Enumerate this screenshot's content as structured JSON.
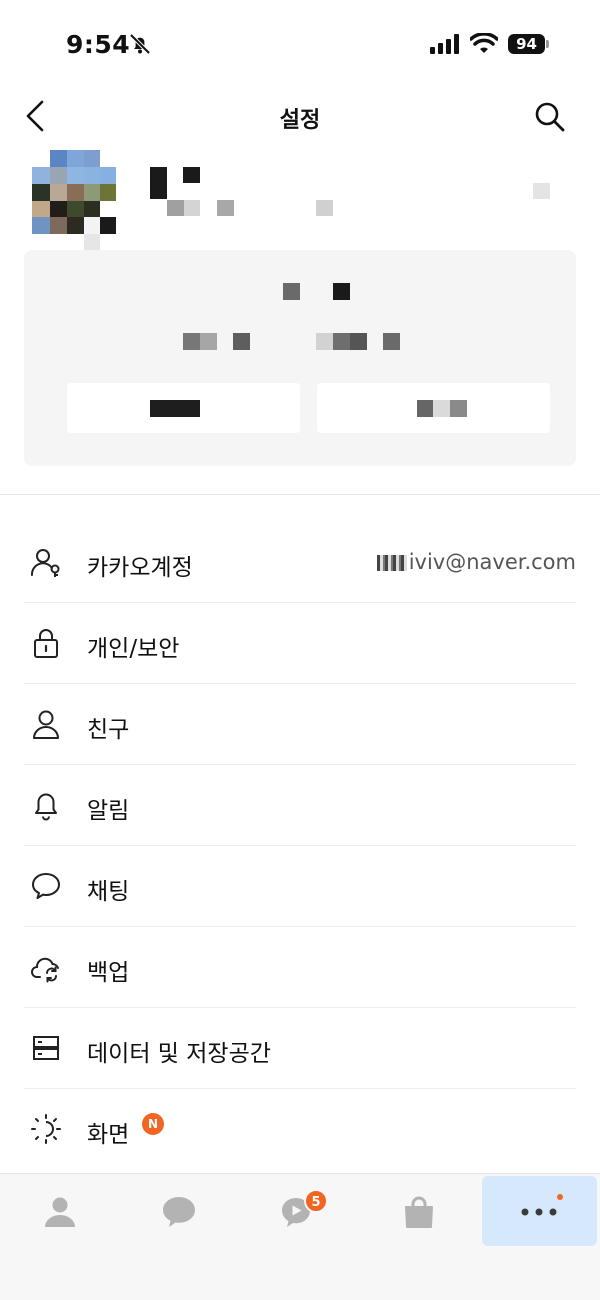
{
  "status_bar": {
    "time": "9:54",
    "battery_percent": "94",
    "icons": [
      "bell-slash-icon",
      "cellular-signal-icon",
      "wifi-icon",
      "battery-icon"
    ]
  },
  "header": {
    "title": "설정",
    "icons": [
      "back-icon",
      "search-icon"
    ]
  },
  "menu": {
    "items": [
      {
        "label": "카카오계정",
        "icon": "account-icon",
        "value": "iviv@naver.com"
      },
      {
        "label": "개인/보안",
        "icon": "lock-icon"
      },
      {
        "label": "친구",
        "icon": "person-icon"
      },
      {
        "label": "알림",
        "icon": "bell-icon"
      },
      {
        "label": "채팅",
        "icon": "chat-bubble-icon"
      },
      {
        "label": "백업",
        "icon": "cloud-sync-icon"
      },
      {
        "label": "데이터 및 저장공간",
        "icon": "storage-icon"
      },
      {
        "label": "화면",
        "icon": "brightness-icon",
        "badge": "N"
      }
    ]
  },
  "tab_bar": {
    "tabs": [
      {
        "name": "friends",
        "icon": "person-icon"
      },
      {
        "name": "chats",
        "icon": "chat-icon"
      },
      {
        "name": "openchat",
        "icon": "openchat-icon",
        "badge": "5"
      },
      {
        "name": "shopping",
        "icon": "shopping-bag-icon"
      },
      {
        "name": "more",
        "icon": "more-icon",
        "selected": true
      }
    ]
  },
  "colors": {
    "accent_badge": "#f26522",
    "selected_tab_bg": "#d6e8fb",
    "card_bg": "#f5f5f5"
  }
}
